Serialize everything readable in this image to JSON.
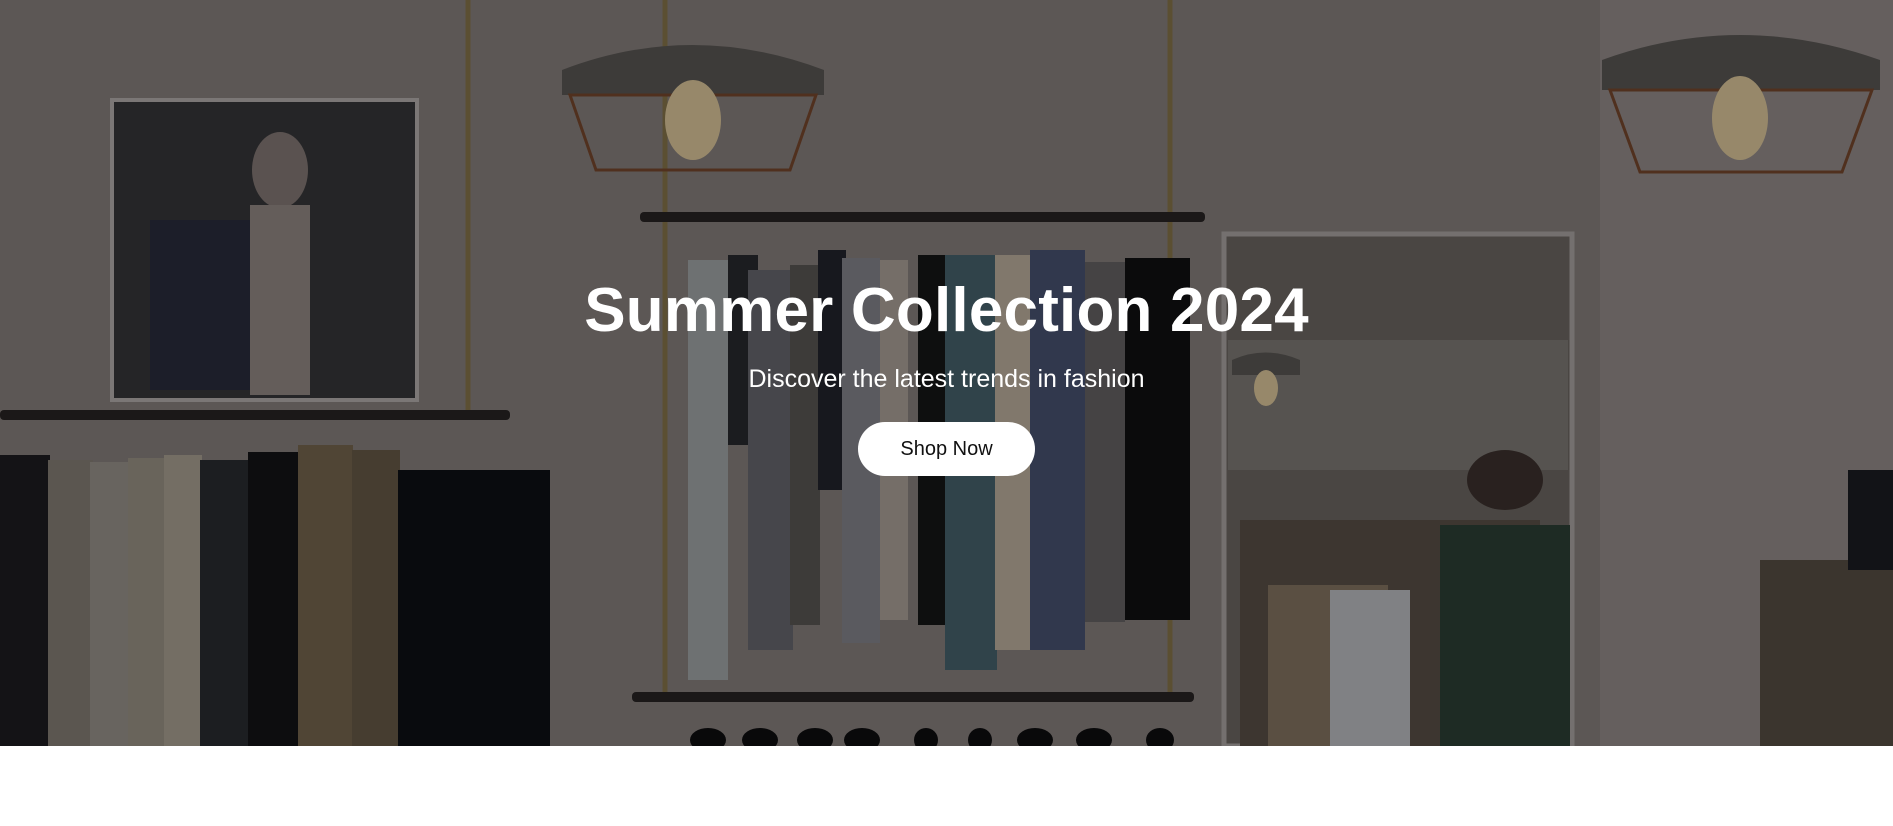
{
  "hero": {
    "title": "Summer Collection 2024",
    "subtitle": "Discover the latest trends in fashion",
    "button_label": "Shop Now",
    "background_image": "clothing-store-interior",
    "overlay_color": "#000000"
  },
  "colors": {
    "text_on_hero": "#ffffff",
    "button_background": "#ffffff",
    "button_text": "#111111",
    "page_background": "#ffffff"
  }
}
